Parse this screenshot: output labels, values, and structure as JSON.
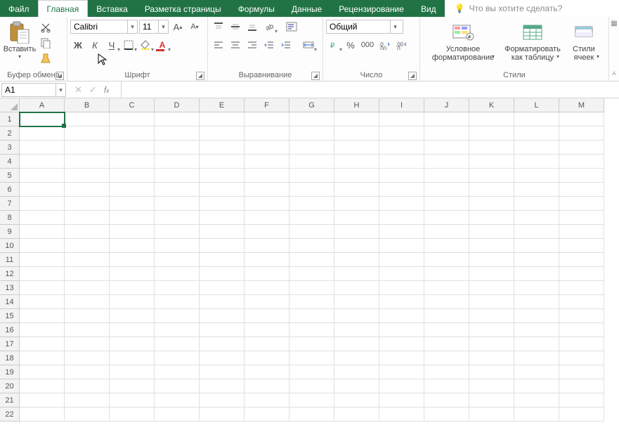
{
  "tabs": {
    "file": "Файл",
    "items": [
      "Главная",
      "Вставка",
      "Разметка страницы",
      "Формулы",
      "Данные",
      "Рецензирование",
      "Вид"
    ],
    "active_index": 0,
    "tell_me": "Что вы хотите сделать?"
  },
  "ribbon": {
    "clipboard": {
      "paste": "Вставить",
      "label": "Буфер обмена"
    },
    "font": {
      "family": "Calibri",
      "size": "11",
      "label": "Шрифт"
    },
    "alignment": {
      "label": "Выравнивание"
    },
    "number": {
      "format": "Общий",
      "label": "Число"
    },
    "styles": {
      "cond": "Условное форматирование",
      "table": "Форматировать как таблицу",
      "cell": "Стили ячеек",
      "label": "Стили"
    }
  },
  "namebox": "A1",
  "formula": "",
  "grid": {
    "columns": [
      "A",
      "B",
      "C",
      "D",
      "E",
      "F",
      "G",
      "H",
      "I",
      "J",
      "K",
      "L",
      "M"
    ],
    "rows": 22,
    "selected": "A1"
  }
}
